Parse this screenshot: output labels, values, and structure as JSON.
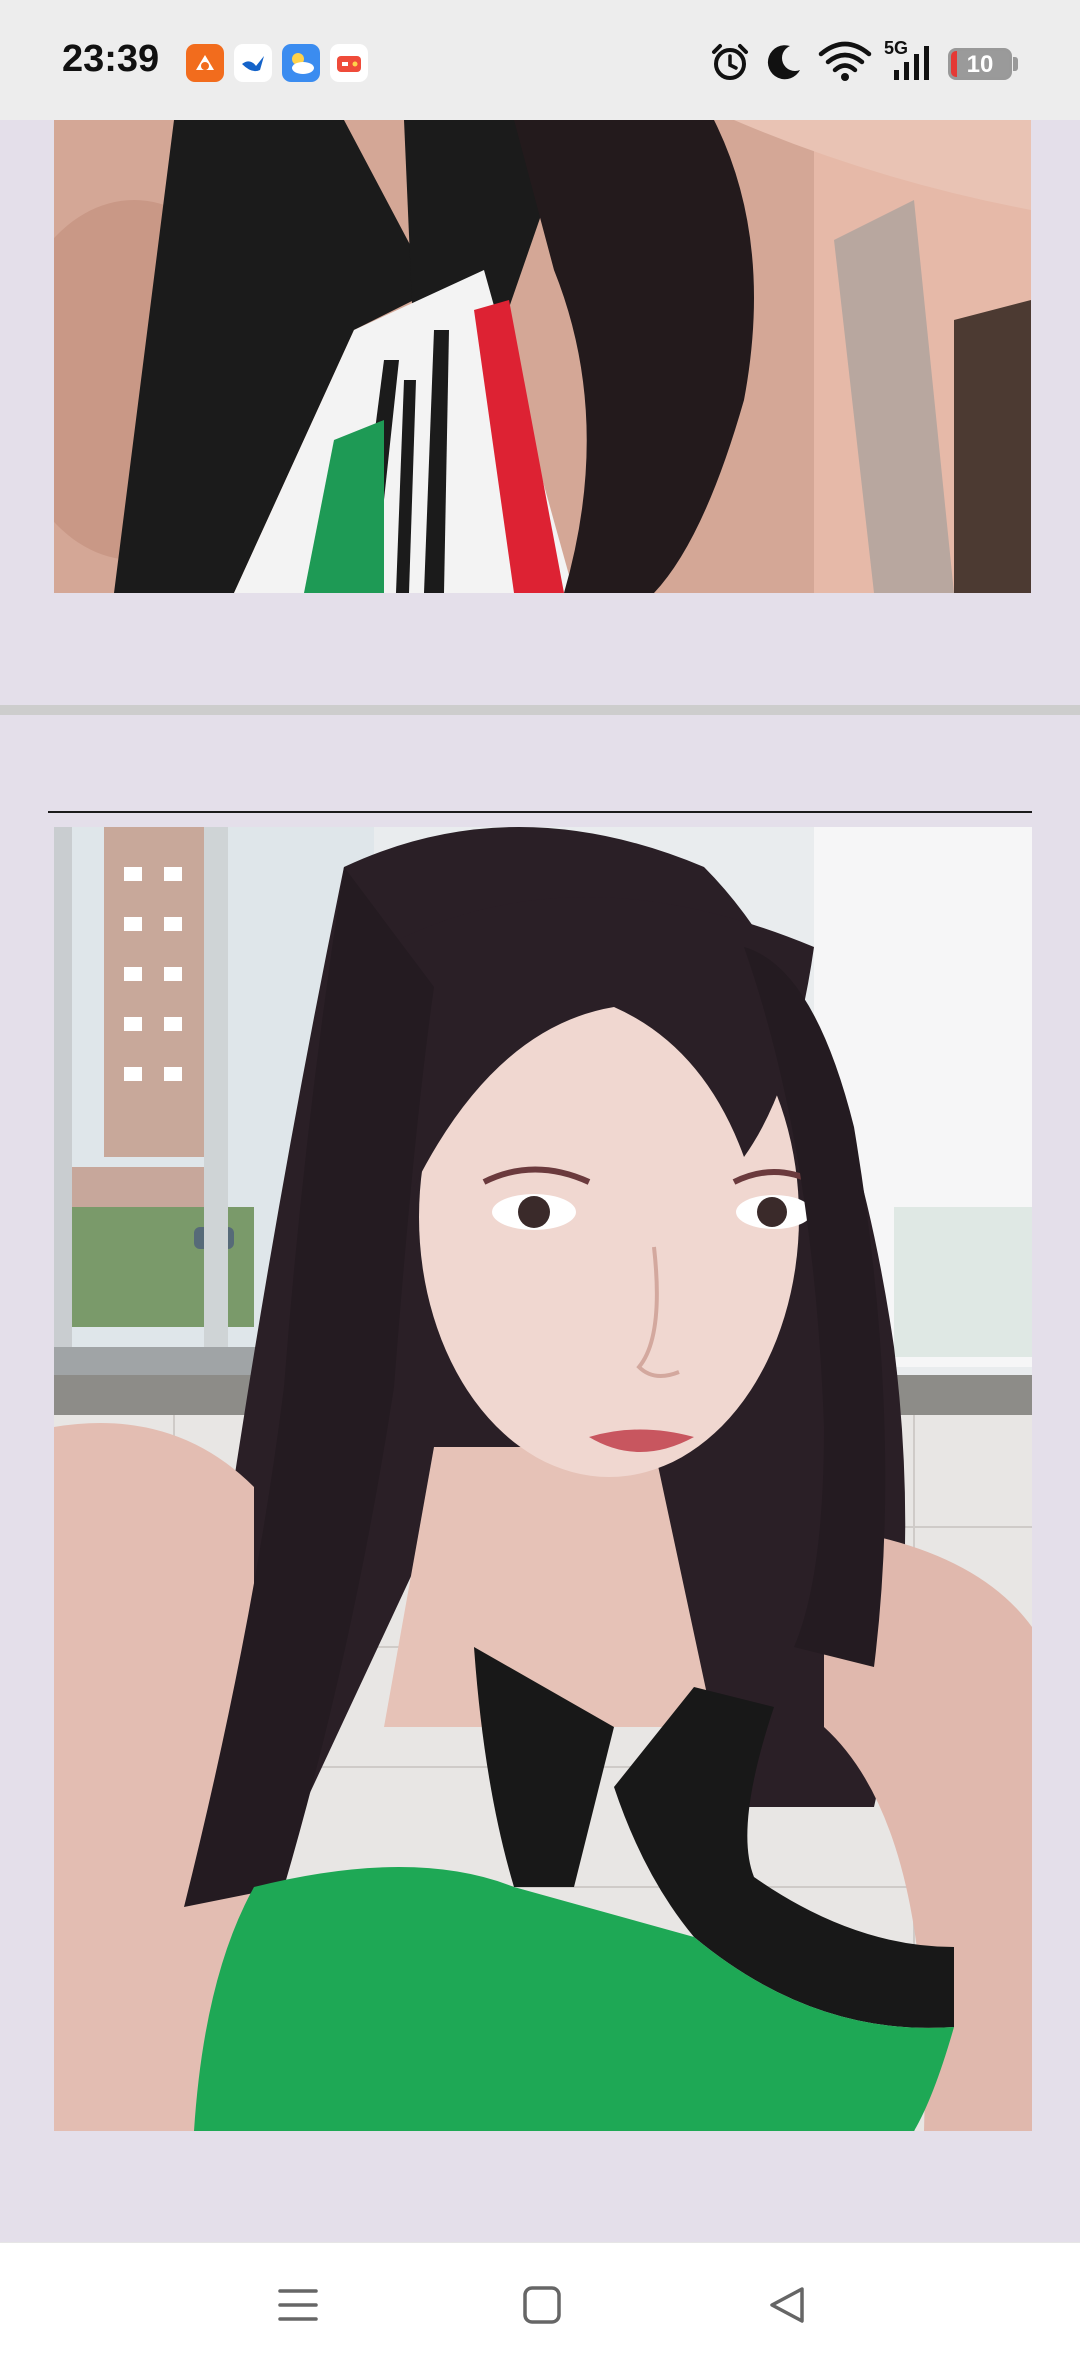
{
  "status_bar": {
    "time": "23:39",
    "battery_level": "10",
    "battery_fraction": 0.1,
    "network_label": "5G",
    "app_icons": [
      "orange-app-icon",
      "blue-bird-app-icon",
      "weather-app-icon",
      "red-game-app-icon"
    ],
    "status_icons": [
      "alarm-icon",
      "moon-icon",
      "wifi-icon",
      "signal-icon",
      "battery-icon"
    ]
  },
  "content": {
    "photos": [
      {
        "name": "top-photo",
        "subject": "selfie-cropped-torso"
      },
      {
        "name": "main-photo",
        "subject": "selfie-portrait"
      }
    ]
  },
  "nav_bar": {
    "buttons": [
      "menu-icon",
      "home-icon",
      "back-icon"
    ]
  },
  "colors": {
    "background": "#e4dfea",
    "status_bar": "#ededed",
    "nav_bar": "#ffffff",
    "battery_low": "#e53935",
    "top_green": "#1ea855"
  }
}
